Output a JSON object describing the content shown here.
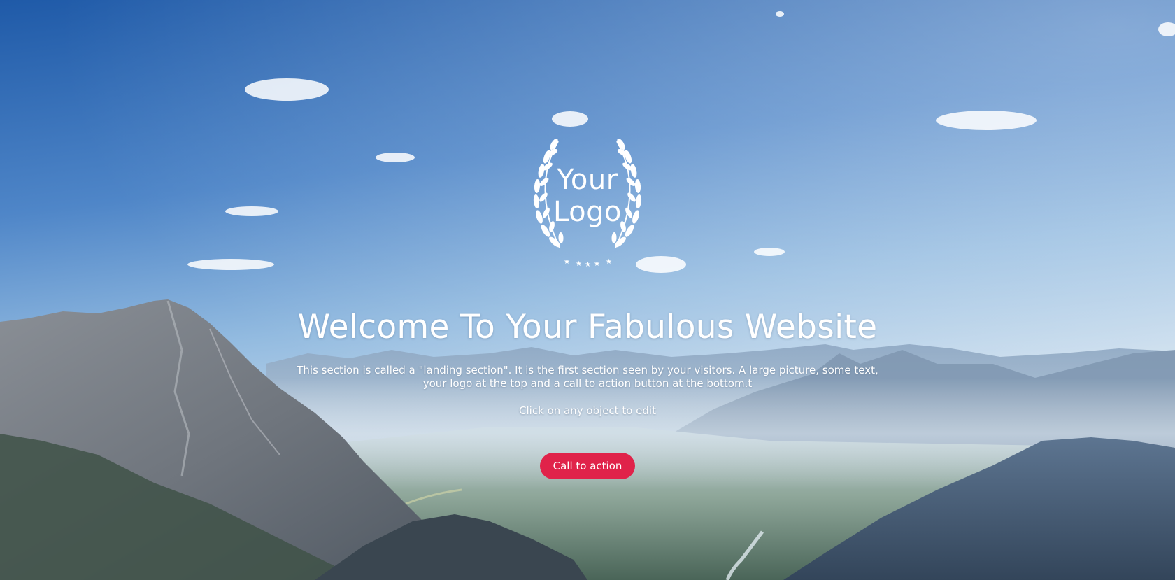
{
  "background": {
    "description_icon": "mountain-landscape-photo",
    "colors": {
      "sky_top": "#2f6bb5",
      "sky_mid": "#6fa0d6",
      "haze": "#c9dcea",
      "mountain_dark": "#3f4e5d",
      "accent": "#e0234a"
    }
  },
  "logo": {
    "line1": "Your",
    "line2": "Logo",
    "icon": "laurel-wreath-icon"
  },
  "landing": {
    "headline": "Welcome To Your Fabulous Website",
    "description": "This section is called a \"landing section\". It is the first section seen by your visitors. A large picture, some text, your logo at the top and a call to action button at the bottom.t",
    "edit_hint": "Click on any object to edit",
    "cta_label": "Call to action"
  }
}
